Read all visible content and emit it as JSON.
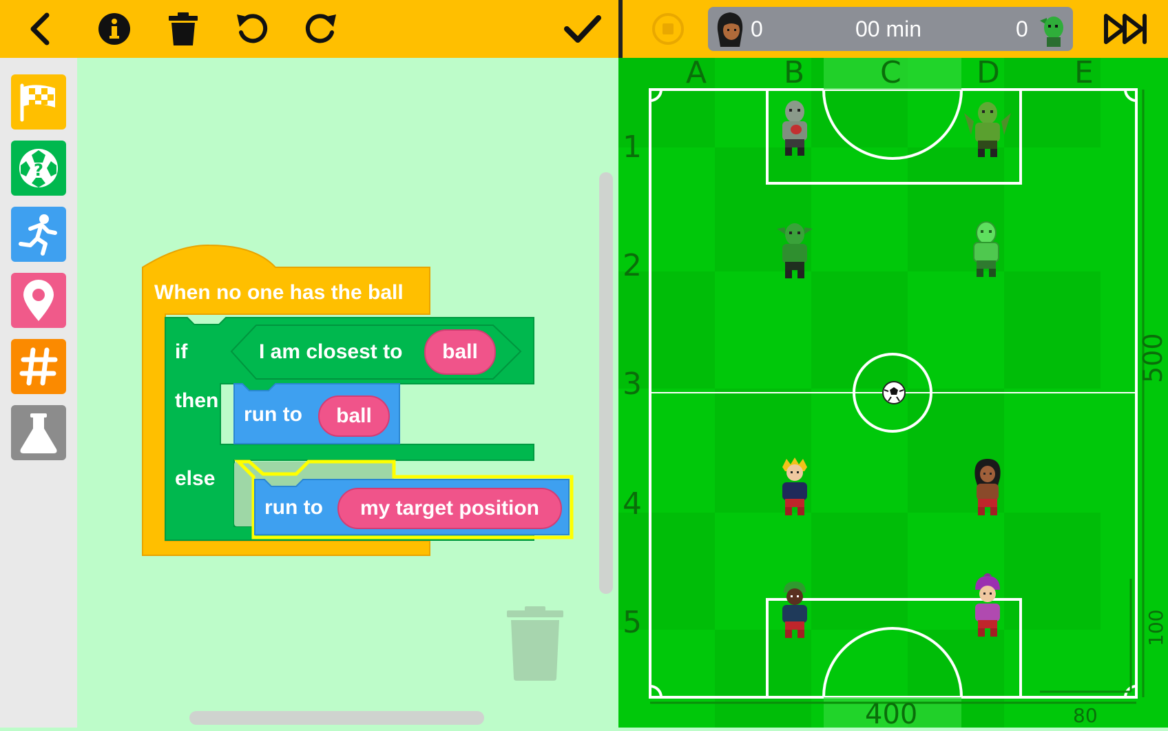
{
  "toolbar_left": {
    "buttons": [
      {
        "name": "back-button",
        "icon": "chevron-left-icon"
      },
      {
        "name": "info-button",
        "icon": "info-icon"
      },
      {
        "name": "delete-button",
        "icon": "trash-icon"
      },
      {
        "name": "undo-button",
        "icon": "undo-icon"
      },
      {
        "name": "redo-button",
        "icon": "redo-icon"
      },
      {
        "name": "confirm-button",
        "icon": "checkmark-icon"
      }
    ]
  },
  "toolbar_right": {
    "stop_icon": "stop-icon",
    "score": {
      "left": "0",
      "time": "00 min",
      "right": "0"
    },
    "fast_forward_icon": "fast-forward-icon"
  },
  "palette": {
    "categories": [
      {
        "name": "start",
        "icon": "checkered-flag-icon",
        "color": "#ffbf00"
      },
      {
        "name": "ball",
        "icon": "soccer-ball-question-icon",
        "color": "#00b84e"
      },
      {
        "name": "movement",
        "icon": "running-person-icon",
        "color": "#3ea0f0"
      },
      {
        "name": "position",
        "icon": "location-pin-icon",
        "color": "#f05a8a"
      },
      {
        "name": "numbers",
        "icon": "hash-icon",
        "color": "#fb8a00"
      },
      {
        "name": "experiment",
        "icon": "flask-icon",
        "color": "#8c8c8c"
      }
    ]
  },
  "blocks": {
    "event_label": "When no one has the ball",
    "if_label": "if",
    "then_label": "then",
    "else_label": "else",
    "condition_label": "I am closest to",
    "condition_target": "ball",
    "then_action": "run to",
    "then_target": "ball",
    "else_action": "run to",
    "else_target": "my target position"
  },
  "field": {
    "columns": [
      "A",
      "B",
      "C",
      "D",
      "E"
    ],
    "rows": [
      "1",
      "2",
      "3",
      "4",
      "5"
    ],
    "width_label": "400",
    "height_label": "500",
    "box_height_label": "100",
    "box_width_label": "80"
  },
  "colors": {
    "toolbar": "#ffbf00",
    "workspace": "#bdfcc9",
    "field": "#00c80a",
    "event_block": "#ffbf00",
    "control_block": "#00b84e",
    "motion_block": "#3ea0f0",
    "value_pill": "#f0548a"
  }
}
